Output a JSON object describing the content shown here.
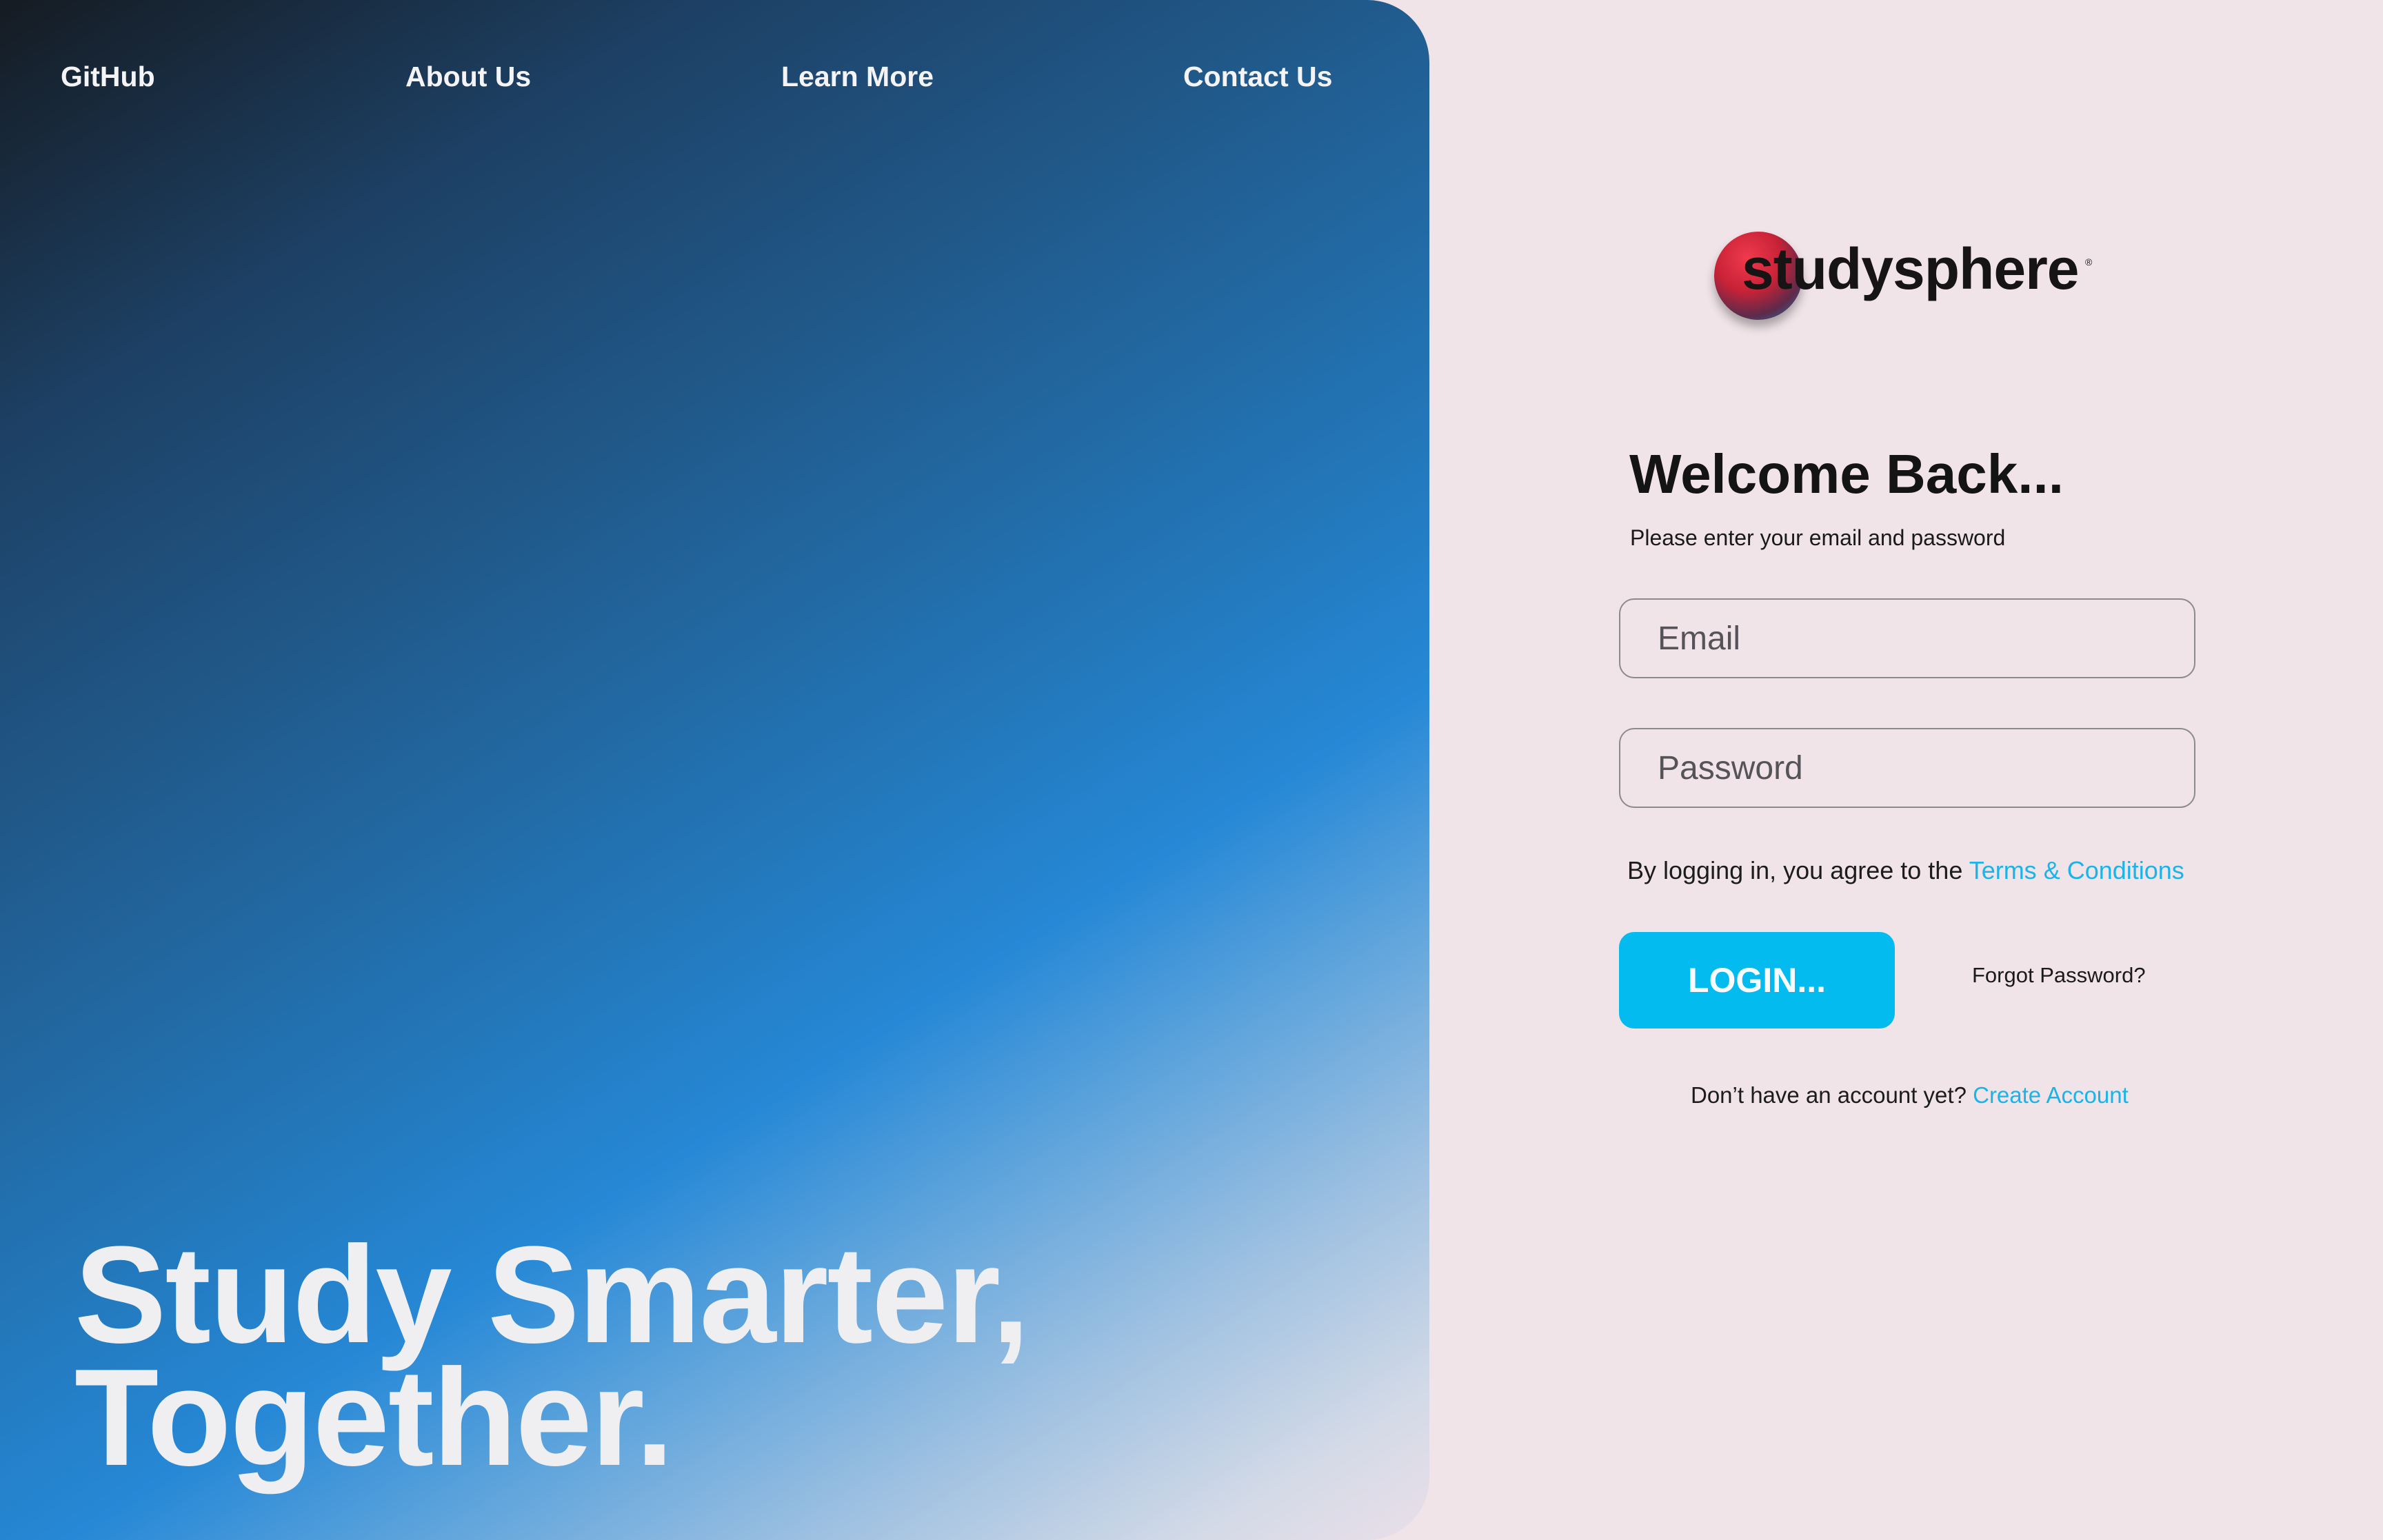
{
  "nav": {
    "github": "GitHub",
    "about": "About Us",
    "learn": "Learn More",
    "contact": "Contact Us"
  },
  "hero": {
    "headline_line1": "Study Smarter,",
    "headline_line2": "Together."
  },
  "brand": {
    "name": "studysphere",
    "registered_mark": "®"
  },
  "login": {
    "title": "Welcome Back...",
    "subtitle": "Please enter your email and password",
    "email_placeholder": "Email",
    "password_placeholder": "Password",
    "agree_text": "By logging in, you agree to the ",
    "terms_link": "Terms & Conditions",
    "login_button": "LOGIN...",
    "forgot_password": "Forgot Password?",
    "no_account_text": "Don’t have an account yet? ",
    "create_account_link": "Create Account"
  },
  "colors": {
    "accent": "#04bbef",
    "link": "#1ab4e8",
    "background": "#f0e4e9"
  }
}
